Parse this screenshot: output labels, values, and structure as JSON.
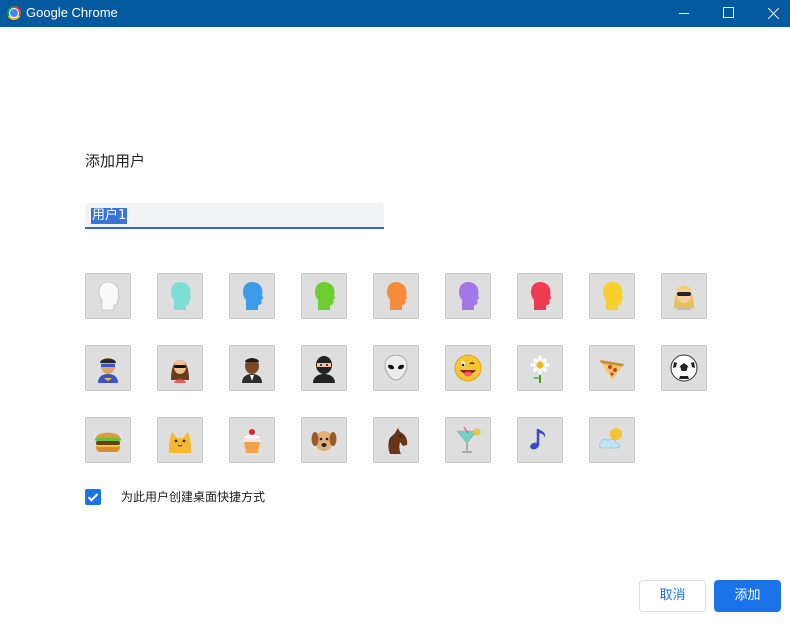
{
  "window": {
    "title": "Google Chrome",
    "titlebar_color": "#035a9f"
  },
  "dialog": {
    "title": "添加用户",
    "name_input": {
      "value": "用户1",
      "selection_color": "#3875d7"
    },
    "avatars": [
      {
        "icon": "person-silhouette-white-icon",
        "selected": false
      },
      {
        "icon": "person-silhouette-teal-icon",
        "selected": false
      },
      {
        "icon": "person-silhouette-blue-icon",
        "selected": false
      },
      {
        "icon": "person-silhouette-green-icon",
        "selected": false
      },
      {
        "icon": "person-silhouette-orange-icon",
        "selected": false
      },
      {
        "icon": "person-silhouette-purple-icon",
        "selected": false
      },
      {
        "icon": "person-silhouette-red-icon",
        "selected": false
      },
      {
        "icon": "person-silhouette-yellow-icon",
        "selected": false
      },
      {
        "icon": "blonde-person-icon",
        "selected": false
      },
      {
        "icon": "superhero-icon",
        "selected": false
      },
      {
        "icon": "woman-sunglasses-icon",
        "selected": false
      },
      {
        "icon": "man-suit-icon",
        "selected": false
      },
      {
        "icon": "ninja-icon",
        "selected": false
      },
      {
        "icon": "alien-icon",
        "selected": false
      },
      {
        "icon": "smiley-tongue-icon",
        "selected": false
      },
      {
        "icon": "flower-icon",
        "selected": false
      },
      {
        "icon": "pizza-icon",
        "selected": false
      },
      {
        "icon": "soccer-ball-icon",
        "selected": false
      },
      {
        "icon": "burger-icon",
        "selected": false
      },
      {
        "icon": "cat-icon",
        "selected": false
      },
      {
        "icon": "cupcake-icon",
        "selected": false
      },
      {
        "icon": "dog-icon",
        "selected": false
      },
      {
        "icon": "horse-icon",
        "selected": false
      },
      {
        "icon": "cocktail-icon",
        "selected": false
      },
      {
        "icon": "music-note-icon",
        "selected": false
      },
      {
        "icon": "sun-cloud-icon",
        "selected": false
      }
    ],
    "shortcut_checkbox": {
      "checked": true,
      "label": "为此用户创建桌面快捷方式"
    },
    "buttons": {
      "cancel": "取消",
      "add": "添加"
    },
    "accent_color": "#1a73e8"
  }
}
